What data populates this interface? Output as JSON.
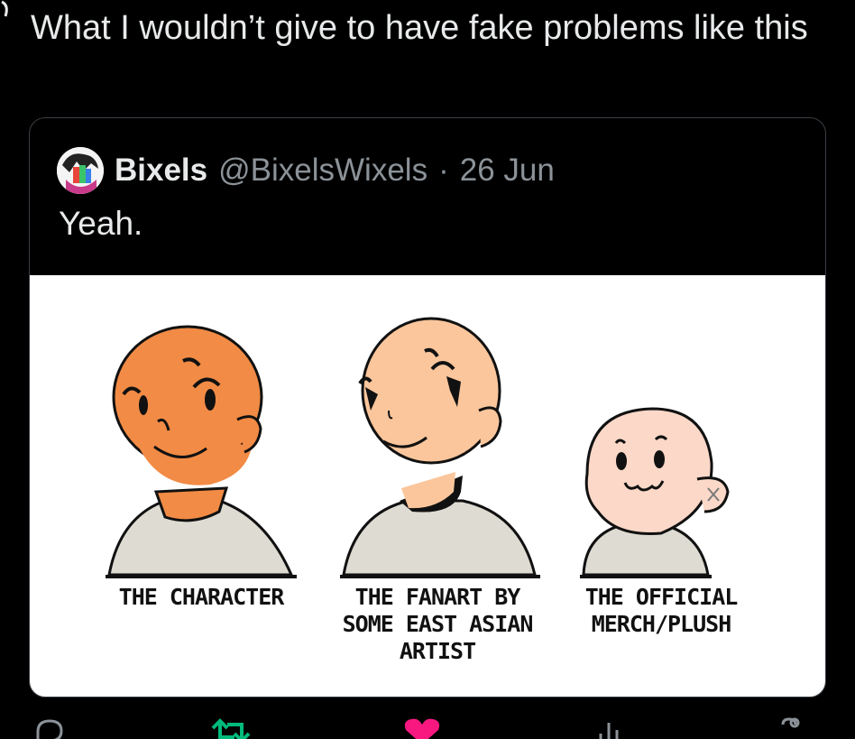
{
  "tweet": {
    "text": "What I wouldn’t give to have fake problems like this"
  },
  "quoted_tweet": {
    "author_name": "Bixels",
    "author_handle": "@BixelsWixels",
    "separator": "·",
    "date": "26 Jun",
    "text": "Yeah."
  },
  "comic": {
    "captions": [
      "THE CHARACTER",
      "THE FANART BY\nSOME EAST ASIAN\nARTIST",
      "THE OFFICIAL\nMERCH/PLUSH"
    ]
  },
  "colors": {
    "background": "#000000",
    "text": "#e7e9ea",
    "muted": "#8b9298",
    "character_orange": "#f28b45",
    "fanart_peach": "#fbc69c",
    "plush_pink": "#fbd8c8",
    "shirt": "#dedbd2",
    "retweet_green": "#00ba7c",
    "like_pink": "#f91880"
  },
  "actions": [
    {
      "icon": "reply-icon"
    },
    {
      "icon": "retweet-icon"
    },
    {
      "icon": "like-icon"
    },
    {
      "icon": "views-icon"
    },
    {
      "icon": "bookmark-icon"
    }
  ]
}
